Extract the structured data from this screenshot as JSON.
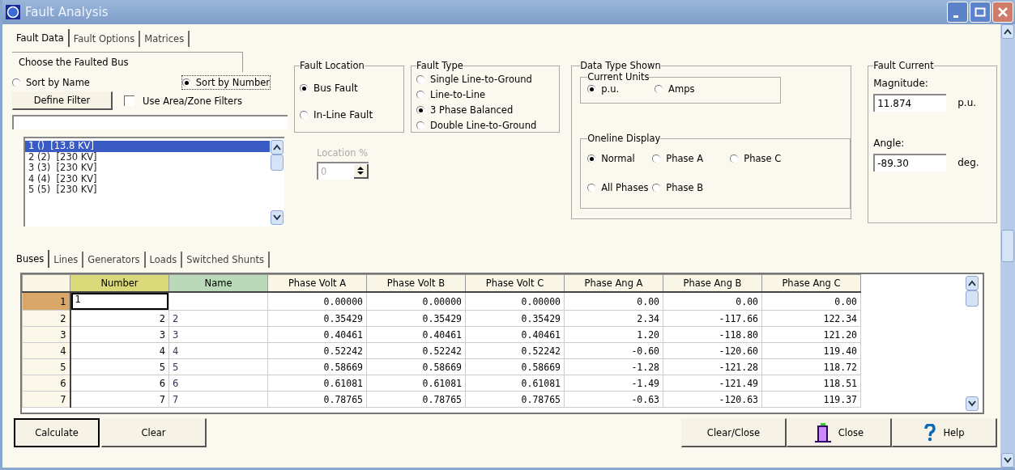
{
  "window": {
    "title": "Fault Analysis"
  },
  "tabs": [
    {
      "label": "Fault Data",
      "selected": true
    },
    {
      "label": "Fault Options",
      "selected": false
    },
    {
      "label": "Matrices",
      "selected": false
    }
  ],
  "bus_chooser": {
    "title": "Choose the Faulted Bus",
    "sort": [
      {
        "label": "Sort by Name",
        "selected": false
      },
      {
        "label": "Sort by Number",
        "selected": true
      }
    ],
    "define_filter": "Define Filter",
    "use_filters": {
      "label": "Use Area/Zone Filters",
      "checked": false
    },
    "buses": [
      {
        "label": "1 ()  [13.8 KV]",
        "selected": true
      },
      {
        "label": "2 (2)  [230 KV]",
        "selected": false
      },
      {
        "label": "3 (3)  [230 KV]",
        "selected": false
      },
      {
        "label": "4 (4)  [230 KV]",
        "selected": false
      },
      {
        "label": "5 (5)  [230 KV]",
        "selected": false
      }
    ]
  },
  "fault_location": {
    "title": "Fault Location",
    "options": [
      {
        "label": "Bus Fault",
        "selected": true
      },
      {
        "label": "In-Line Fault",
        "selected": false
      }
    ],
    "location_percent": {
      "label": "Location %",
      "value": "0",
      "disabled": true
    }
  },
  "fault_type": {
    "title": "Fault Type",
    "options": [
      {
        "label": "Single Line-to-Ground",
        "selected": false
      },
      {
        "label": "Line-to-Line",
        "selected": false
      },
      {
        "label": "3 Phase Balanced",
        "selected": true
      },
      {
        "label": "Double Line-to-Ground",
        "selected": false
      }
    ]
  },
  "data_type_shown": {
    "title": "Data Type Shown",
    "current_units": {
      "title": "Current Units",
      "options": [
        {
          "label": "p.u.",
          "selected": true
        },
        {
          "label": "Amps",
          "selected": false
        }
      ]
    },
    "oneline_display": {
      "title": "Oneline Display",
      "options": [
        {
          "label": "Normal",
          "selected": true
        },
        {
          "label": "Phase A",
          "selected": false
        },
        {
          "label": "Phase C",
          "selected": false
        },
        {
          "label": "All Phases",
          "selected": false
        },
        {
          "label": "Phase B",
          "selected": false
        }
      ]
    }
  },
  "fault_current": {
    "title": "Fault Current",
    "magnitude": {
      "label": "Magnitude:",
      "value": "11.874",
      "unit": "p.u."
    },
    "angle": {
      "label": "Angle:",
      "value": "-89.30",
      "unit": "deg."
    }
  },
  "result_tabs": [
    {
      "label": "Buses",
      "selected": true
    },
    {
      "label": "Lines",
      "selected": false
    },
    {
      "label": "Generators",
      "selected": false
    },
    {
      "label": "Loads",
      "selected": false
    },
    {
      "label": "Switched Shunts",
      "selected": false
    }
  ],
  "table": {
    "columns": [
      {
        "label": "Number",
        "color": "#d9d97a"
      },
      {
        "label": "Name",
        "color": "#b9d9b9"
      },
      {
        "label": "Phase Volt A"
      },
      {
        "label": "Phase Volt B"
      },
      {
        "label": "Phase Volt C"
      },
      {
        "label": "Phase Ang A"
      },
      {
        "label": "Phase Ang B"
      },
      {
        "label": "Phase Ang C"
      }
    ],
    "rows": [
      {
        "header": "1",
        "selected": true,
        "cells": [
          "1",
          "",
          "0.00000",
          "0.00000",
          "0.00000",
          "0.00",
          "0.00",
          "0.00"
        ]
      },
      {
        "header": "2",
        "selected": false,
        "cells": [
          "2",
          "2",
          "0.35429",
          "0.35429",
          "0.35429",
          "2.34",
          "-117.66",
          "122.34"
        ]
      },
      {
        "header": "3",
        "selected": false,
        "cells": [
          "3",
          "3",
          "0.40461",
          "0.40461",
          "0.40461",
          "1.20",
          "-118.80",
          "121.20"
        ]
      },
      {
        "header": "4",
        "selected": false,
        "cells": [
          "4",
          "4",
          "0.52242",
          "0.52242",
          "0.52242",
          "-0.60",
          "-120.60",
          "119.40"
        ]
      },
      {
        "header": "5",
        "selected": false,
        "cells": [
          "5",
          "5",
          "0.58669",
          "0.58669",
          "0.58669",
          "-1.28",
          "-121.28",
          "118.72"
        ]
      },
      {
        "header": "6",
        "selected": false,
        "cells": [
          "6",
          "6",
          "0.61081",
          "0.61081",
          "0.61081",
          "-1.49",
          "-121.49",
          "118.51"
        ]
      },
      {
        "header": "7",
        "selected": false,
        "cells": [
          "7",
          "7",
          "0.78765",
          "0.78765",
          "0.78765",
          "-0.63",
          "-120.63",
          "119.37"
        ]
      }
    ]
  },
  "buttons": {
    "left": [
      "Calculate",
      "Clear"
    ],
    "right": [
      {
        "label": "Clear/Close",
        "kind": "plain"
      },
      {
        "label": "Close",
        "kind": "door"
      },
      {
        "label": "Help",
        "kind": "help"
      }
    ]
  }
}
